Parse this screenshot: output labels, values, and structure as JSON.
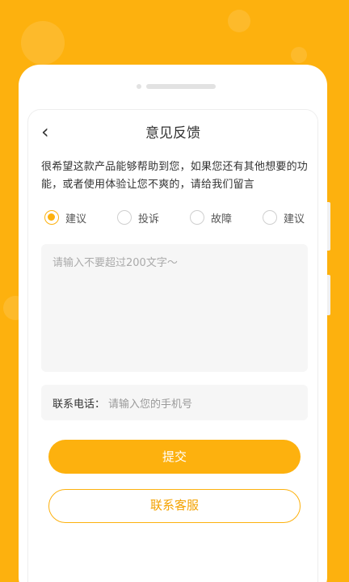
{
  "page": {
    "title": "意见反馈",
    "description": "很希望这款产品能够帮助到您，如果您还有其他想要的功能，或者使用体验让您不爽的，请给我们留言"
  },
  "feedback_types": [
    {
      "label": "建议",
      "checked": true
    },
    {
      "label": "投诉",
      "checked": false
    },
    {
      "label": "故障",
      "checked": false
    },
    {
      "label": "建议",
      "checked": false
    }
  ],
  "content_input": {
    "placeholder": "请输入不要超过200文字～",
    "value": ""
  },
  "phone_input": {
    "label": "联系电话：",
    "placeholder": "请输入您的手机号",
    "value": ""
  },
  "buttons": {
    "submit": "提交",
    "contact": "联系客服"
  },
  "colors": {
    "accent": "#FDB10E",
    "background": "#FDB10E"
  }
}
